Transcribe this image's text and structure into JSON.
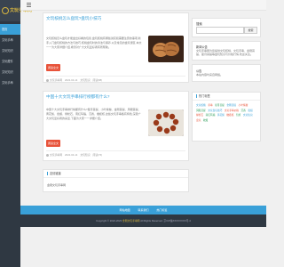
{
  "logo": {
    "text": "文玩手串网"
  },
  "sidebar": {
    "items": [
      {
        "label": "首页",
        "active": true
      },
      {
        "label": "文玩手串"
      },
      {
        "label": "文玩知识"
      },
      {
        "label": "文玩藏件"
      },
      {
        "label": "文玩知识"
      },
      {
        "label": "文玩手串"
      }
    ]
  },
  "articles": [
    {
      "title": "文玩核桃怎么盘玩?盘玩小技巧",
      "excerpt": "文玩核桃怎么盘玩才能盘出好看的包浆,盘玩核桃有哪些讲究和需要注意的事项,新手入门盘玩核桃的方法与技巧,核桃盘玩时的清洁与保养,以及常见的盘玩误区,本文一一为大家详细介绍,希望对广大文玩爱好者有所帮助。",
      "button": "阅读全文",
      "meta": [
        "文玩手串网",
        "2022-04-14",
        "文玩知识",
        "阅读(88)"
      ]
    },
    {
      "title": "中国十大文玩手串排行榜都有什么?",
      "excerpt": "中国十大文玩手串排行榜都有什么?星月菩提、小叶紫檀、金刚菩提、凤眼菩提、黄花梨、蜜蜡、绿松石、南红玛瑙、沉香、橄榄核,这些文玩手串各有特色,深受广大文玩爱好者的喜爱,下面为大家一一详细介绍。",
      "button": "阅读全文",
      "meta": [
        "文玩手串网",
        "2022-04-14",
        "文玩知识",
        "阅读(76)"
      ]
    }
  ],
  "links_panel": {
    "title": "友情链接",
    "text": "金刚文玩手串网"
  },
  "search": {
    "label": "搜索",
    "placeholder": "",
    "button": "搜索"
  },
  "about": {
    "title": "新闻公告",
    "text": "文玩手串网为您提供文玩核桃、文玩手串、金刚菩提、星月菩提等盘玩知识与价格行情,欢迎关注。"
  },
  "notice": {
    "title": "公告",
    "text": "本站内容均来自网络。"
  },
  "hot_tags": {
    "title": "热门标签",
    "tags": [
      {
        "text": "文玩核桃",
        "color": "#39a0d8"
      },
      {
        "text": "手串",
        "color": "#e8533a"
      },
      {
        "text": "星月菩提",
        "color": "#2e9e5b"
      },
      {
        "text": "金刚菩提",
        "color": "#39a0d8"
      },
      {
        "text": "小叶紫檀",
        "color": "#e8533a"
      },
      {
        "text": "凤眼菩提",
        "color": "#2e9e5b"
      },
      {
        "text": "文玩盘玩技巧",
        "color": "#39a0d8"
      },
      {
        "text": "文玩手串价格",
        "color": "#e8533a"
      },
      {
        "text": "沉香",
        "color": "#2e9e5b"
      },
      {
        "text": "蜜蜡",
        "color": "#39a0d8"
      },
      {
        "text": "绿松石",
        "color": "#e8533a"
      },
      {
        "text": "南红玛瑙",
        "color": "#2e9e5b"
      },
      {
        "text": "黄花梨",
        "color": "#39a0d8"
      },
      {
        "text": "橄榄核",
        "color": "#e8533a"
      },
      {
        "text": "包浆",
        "color": "#2e9e5b"
      },
      {
        "text": "文玩知识",
        "color": "#39a0d8"
      },
      {
        "text": "盘玩",
        "color": "#e8533a"
      },
      {
        "text": "收藏",
        "color": "#2e9e5b"
      }
    ]
  },
  "footer_nav": [
    "网站地图",
    "联系我们",
    "热门标签"
  ],
  "footer": {
    "copyright": "Copyright © 2022-2023",
    "brand": "金刚文玩手串网",
    "rights": "All Rights Reserved.",
    "icp": "京ICP备XXXXXXXX号-4"
  },
  "colors": {
    "accent": "#39a0d8",
    "button": "#e8533a",
    "sidebar": "#2f3842",
    "logo": "#d8b640"
  }
}
